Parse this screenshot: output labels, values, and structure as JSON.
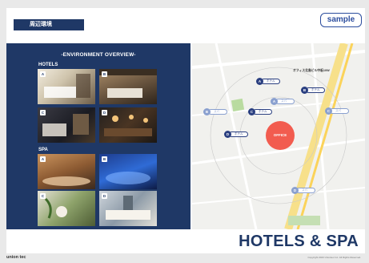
{
  "header": {
    "section_tag": "周辺環境",
    "sample_label": "sample"
  },
  "overview": {
    "title": "-ENVIRONMENT OVERVIEW-",
    "hotels_label": "HOTELS",
    "spa_label": "SPA",
    "hotel_badges": [
      "A",
      "B",
      "C",
      "D"
    ],
    "spa_badges": [
      "A",
      "B",
      "C",
      "D"
    ]
  },
  "map": {
    "office_label": "OFFICE",
    "building_label": "オフィス北島ビル中板10W",
    "pins": [
      {
        "letter": "A",
        "text": "ホテル"
      },
      {
        "letter": "B",
        "text": "ホテル"
      },
      {
        "letter": "A",
        "text": "スパ"
      },
      {
        "letter": "C",
        "text": "ホテル"
      },
      {
        "letter": "D",
        "text": "ホテル"
      },
      {
        "letter": "B",
        "text": "スパ"
      },
      {
        "letter": "C",
        "text": "スパ"
      },
      {
        "letter": "D",
        "text": "スパ"
      }
    ]
  },
  "footer": {
    "title": "HOTELS & SPA",
    "logo": "union tec",
    "copyright": "Copyright 2023 Uniontec Inc. All Rights Reserved."
  },
  "colors": {
    "navy": "#1f3866",
    "accent": "#f25c4f",
    "brand_blue": "#2c4d9e"
  }
}
